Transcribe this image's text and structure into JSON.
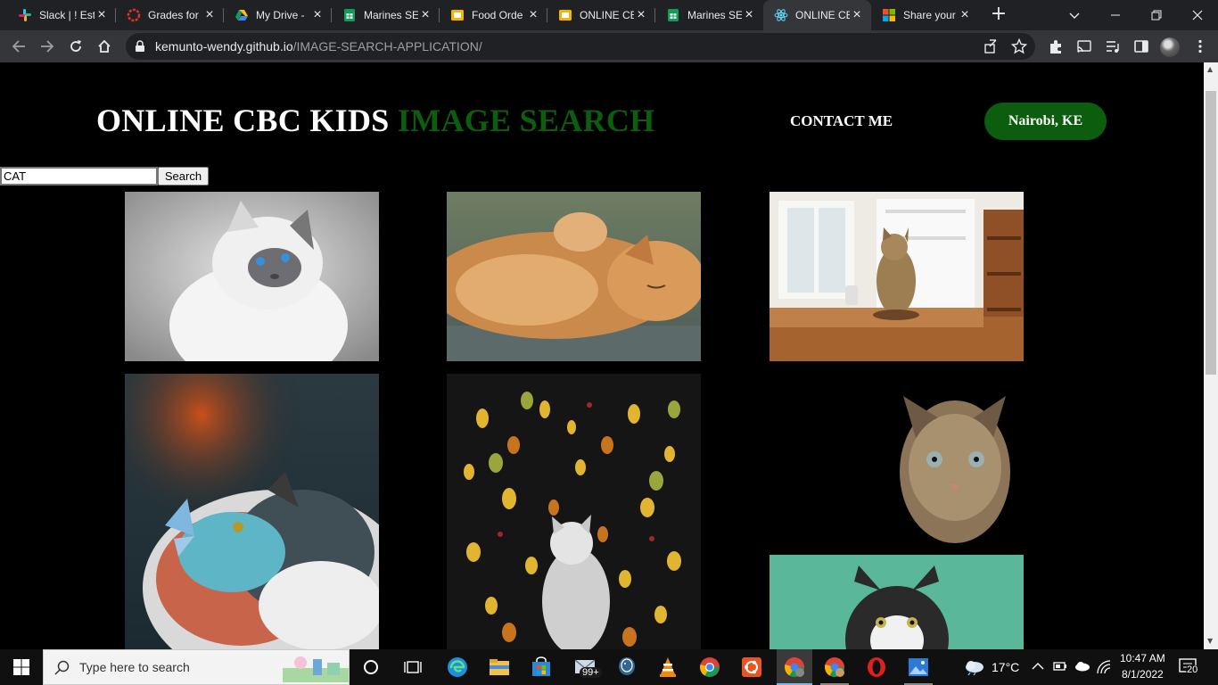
{
  "browser": {
    "tabs": [
      {
        "title": "Slack | ! Est",
        "icon": "slack-icon",
        "active": false
      },
      {
        "title": "Grades for",
        "icon": "grades-icon",
        "active": false
      },
      {
        "title": "My Drive -",
        "icon": "google-drive-icon",
        "active": false
      },
      {
        "title": "Marines SE",
        "icon": "google-sheets-icon",
        "active": false
      },
      {
        "title": "Food Orde",
        "icon": "google-slides-icon",
        "active": false
      },
      {
        "title": "ONLINE CB",
        "icon": "google-slides-icon",
        "active": false
      },
      {
        "title": "Marines SE",
        "icon": "google-sheets-icon",
        "active": false
      },
      {
        "title": "ONLINE CB",
        "icon": "react-icon",
        "active": true
      },
      {
        "title": "Share your",
        "icon": "microsoft-icon",
        "active": false
      }
    ],
    "url_host": "kemunto-wendy.github.io",
    "url_path": "/IMAGE-SEARCH-APPLICATION/"
  },
  "page": {
    "title_main": "ONLINE CBC KIDS ",
    "title_accent": "IMAGE SEARCH",
    "contact_label": "CONTACT ME",
    "location_label": "Nairobi, KE",
    "search_value": "CAT",
    "search_button": "Search"
  },
  "taskbar": {
    "search_placeholder": "Type here to search",
    "mail_badge": "99+",
    "temperature": "17°C",
    "time": "10:47 AM",
    "date": "8/1/2022",
    "notification_count": "20"
  },
  "colors": {
    "accent_green": "#0c5e0e",
    "page_bg": "#000000",
    "chrome_dark": "#202124"
  }
}
